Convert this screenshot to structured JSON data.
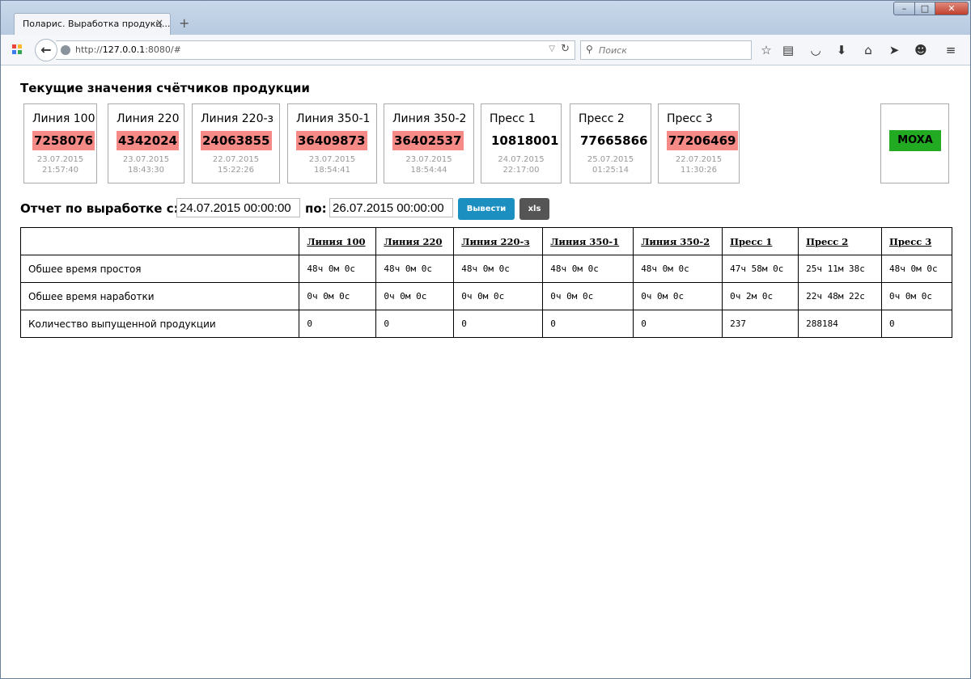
{
  "browser": {
    "tab_title": "Поларис. Выработка продукц...",
    "tab_close": "×",
    "new_tab": "+",
    "url_prefix": "http://",
    "url_host": "127.0.0.1",
    "url_rest": ":8080/#",
    "search_placeholder": "Поиск"
  },
  "page": {
    "counters_heading": "Текущие значения счётчиков продукции",
    "report_label": "Отчет по выработке с:",
    "report_to_label": "по:",
    "date_from": "24.07.2015 00:00:00",
    "date_to": "26.07.2015 00:00:00",
    "run_button": "Вывести",
    "xls_button": "xls",
    "moxa_label": "MOXA"
  },
  "counters": [
    {
      "name": "Линия 100",
      "value": "7258076",
      "date": "23.07.2015",
      "time": "21:57:40",
      "alarm": true
    },
    {
      "name": "Линия 220",
      "value": "4342024",
      "date": "23.07.2015",
      "time": "18:43:30",
      "alarm": true
    },
    {
      "name": "Линия 220-з",
      "value": "24063855",
      "date": "22.07.2015",
      "time": "15:22:26",
      "alarm": true
    },
    {
      "name": "Линия 350-1",
      "value": "36409873",
      "date": "23.07.2015",
      "time": "18:54:41",
      "alarm": true
    },
    {
      "name": "Линия 350-2",
      "value": "36402537",
      "date": "23.07.2015",
      "time": "18:54:44",
      "alarm": true
    },
    {
      "name": "Пресс 1",
      "value": "10818001",
      "date": "24.07.2015",
      "time": "22:17:00",
      "alarm": false
    },
    {
      "name": "Пресс 2",
      "value": "77665866",
      "date": "25.07.2015",
      "time": "01:25:14",
      "alarm": false
    },
    {
      "name": "Пресс 3",
      "value": "77206469",
      "date": "22.07.2015",
      "time": "11:30:26",
      "alarm": true
    }
  ],
  "colors": {
    "alarm": "#f58a86",
    "moxa_ok": "#22aa22",
    "run_button": "#1b8fbf",
    "xls_button": "#555555"
  },
  "table": {
    "columns": [
      "Линия 100",
      "Линия 220",
      "Линия 220-з",
      "Линия 350-1",
      "Линия 350-2",
      "Пресс 1",
      "Пресс 2",
      "Пресс 3"
    ],
    "rows": [
      {
        "label": "Обшее время простоя",
        "cells": [
          "48ч 0м 0с",
          "48ч 0м 0с",
          "48ч 0м 0с",
          "48ч 0м 0с",
          "48ч 0м 0с",
          "47ч 58м 0с",
          "25ч 11м 38с",
          "48ч 0м 0с"
        ]
      },
      {
        "label": "Обшее время наработки",
        "cells": [
          "0ч 0м 0с",
          "0ч 0м 0с",
          "0ч 0м 0с",
          "0ч 0м 0с",
          "0ч 0м 0с",
          "0ч 2м 0с",
          "22ч 48м 22с",
          "0ч 0м 0с"
        ]
      },
      {
        "label": "Количество выпущенной продукции",
        "cells": [
          "0",
          "0",
          "0",
          "0",
          "0",
          "237",
          "288184",
          "0"
        ]
      }
    ]
  }
}
